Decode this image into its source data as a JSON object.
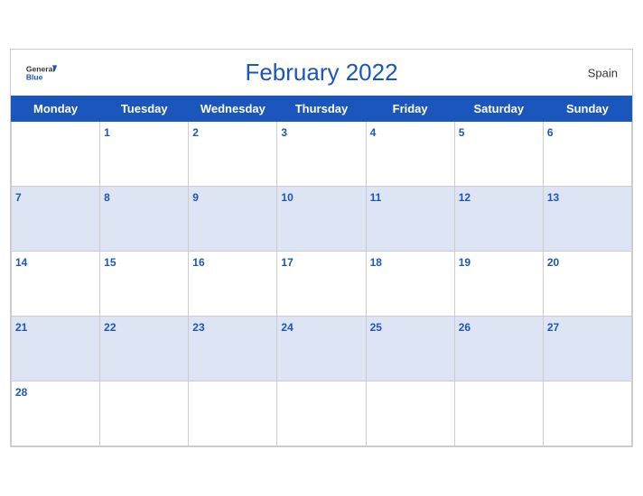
{
  "header": {
    "title": "February 2022",
    "country": "Spain",
    "logo_line1": "General",
    "logo_line2": "Blue"
  },
  "weekdays": [
    "Monday",
    "Tuesday",
    "Wednesday",
    "Thursday",
    "Friday",
    "Saturday",
    "Sunday"
  ],
  "weeks": [
    [
      {
        "day": null,
        "shaded": false
      },
      {
        "day": "1",
        "shaded": false
      },
      {
        "day": "2",
        "shaded": false
      },
      {
        "day": "3",
        "shaded": false
      },
      {
        "day": "4",
        "shaded": false
      },
      {
        "day": "5",
        "shaded": false
      },
      {
        "day": "6",
        "shaded": false
      }
    ],
    [
      {
        "day": "7",
        "shaded": true
      },
      {
        "day": "8",
        "shaded": true
      },
      {
        "day": "9",
        "shaded": true
      },
      {
        "day": "10",
        "shaded": true
      },
      {
        "day": "11",
        "shaded": true
      },
      {
        "day": "12",
        "shaded": true
      },
      {
        "day": "13",
        "shaded": true
      }
    ],
    [
      {
        "day": "14",
        "shaded": false
      },
      {
        "day": "15",
        "shaded": false
      },
      {
        "day": "16",
        "shaded": false
      },
      {
        "day": "17",
        "shaded": false
      },
      {
        "day": "18",
        "shaded": false
      },
      {
        "day": "19",
        "shaded": false
      },
      {
        "day": "20",
        "shaded": false
      }
    ],
    [
      {
        "day": "21",
        "shaded": true
      },
      {
        "day": "22",
        "shaded": true
      },
      {
        "day": "23",
        "shaded": true
      },
      {
        "day": "24",
        "shaded": true
      },
      {
        "day": "25",
        "shaded": true
      },
      {
        "day": "26",
        "shaded": true
      },
      {
        "day": "27",
        "shaded": true
      }
    ],
    [
      {
        "day": "28",
        "shaded": false
      },
      {
        "day": null,
        "shaded": false
      },
      {
        "day": null,
        "shaded": false
      },
      {
        "day": null,
        "shaded": false
      },
      {
        "day": null,
        "shaded": false
      },
      {
        "day": null,
        "shaded": false
      },
      {
        "day": null,
        "shaded": false
      }
    ]
  ]
}
